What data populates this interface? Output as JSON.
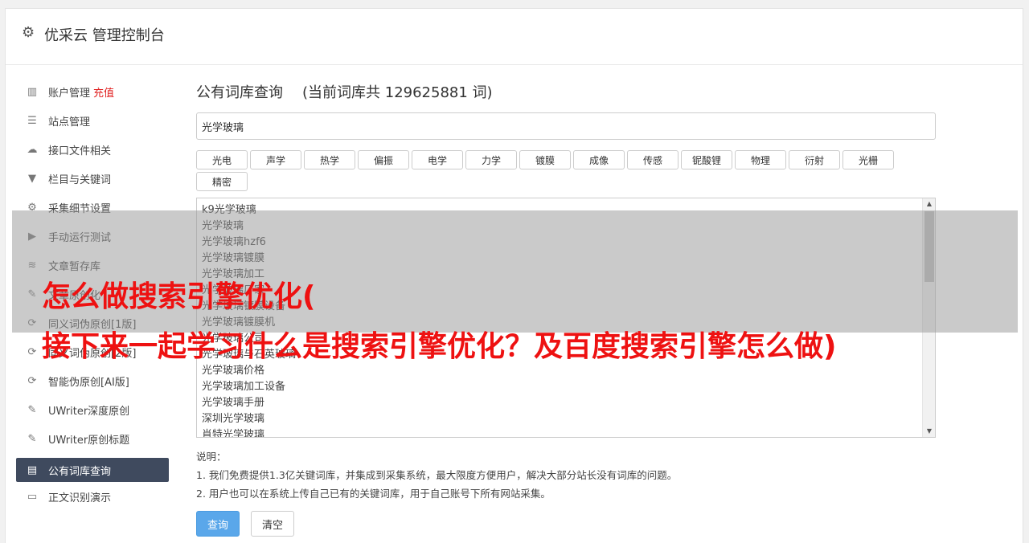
{
  "header": {
    "title": "优采云 管理控制台",
    "icon": "gear-icon"
  },
  "sidebar": {
    "items": [
      {
        "label": "账户管理",
        "extra": "充值",
        "icon": "bar-chart-icon",
        "glyph": "▥"
      },
      {
        "label": "站点管理",
        "icon": "server-icon",
        "glyph": "☰"
      },
      {
        "label": "接口文件相关",
        "icon": "cloud-upload-icon",
        "glyph": "☁"
      },
      {
        "label": "栏目与关键词",
        "icon": "filter-icon",
        "glyph": "▼"
      },
      {
        "label": "采集细节设置",
        "icon": "cogs-icon",
        "glyph": "⚙"
      },
      {
        "label": "手动运行测试",
        "icon": "play-circle-icon",
        "glyph": "▶"
      },
      {
        "label": "文章暂存库",
        "icon": "database-icon",
        "glyph": "≋"
      },
      {
        "label": "文章原创化",
        "icon": "edit-icon",
        "glyph": "✎"
      },
      {
        "label": "同义词伪原创[1版]",
        "icon": "refresh-icon",
        "glyph": "⟳"
      },
      {
        "label": "同义词伪原创[2版]",
        "icon": "refresh-icon",
        "glyph": "⟳"
      },
      {
        "label": "智能伪原创[AI版]",
        "icon": "refresh-icon",
        "glyph": "⟳"
      },
      {
        "label": "UWriter深度原创",
        "icon": "edit-icon",
        "glyph": "✎"
      },
      {
        "label": "UWriter原创标题",
        "icon": "edit-icon",
        "glyph": "✎"
      },
      {
        "label": "公有词库查询",
        "icon": "book-icon",
        "glyph": "▤",
        "active": true
      },
      {
        "label": "正文识别演示",
        "icon": "monitor-icon",
        "glyph": "▭"
      }
    ]
  },
  "main": {
    "title": "公有词库查询",
    "count_text": "(当前词库共 129625881 词)",
    "search_value": "光学玻璃",
    "tags": [
      "光电",
      "声学",
      "热学",
      "偏振",
      "电学",
      "力学",
      "镀膜",
      "成像",
      "传感",
      "铌酸锂",
      "物理",
      "衍射",
      "光栅",
      "精密"
    ],
    "results": [
      "k9光学玻璃",
      "光学玻璃",
      "光学玻璃hzf6",
      "光学玻璃镀膜",
      "光学玻璃加工",
      "光学玻璃厂家",
      "光学玻璃镀膜设备",
      "光学玻璃镀膜机",
      "光学玻璃公司",
      "光学玻璃与石英玻璃",
      "光学玻璃价格",
      "光学玻璃加工设备",
      "光学玻璃手册",
      "深圳光学玻璃",
      "肖特光学玻璃"
    ],
    "notes_title": "说明：",
    "notes": [
      "1. 我们免费提供1.3亿关键词库，并集成到采集系统，最大限度方便用户，解决大部分站长没有词库的问题。",
      "2. 用户也可以在系统上传自己已有的关键词库，用于自己账号下所有网站采集。"
    ],
    "query_button": "查询",
    "clear_button": "清空"
  },
  "overlay": {
    "line1": "怎么做搜索引擎优化(",
    "line2": "接下来一起学习什么是搜索引擎优化？及百度搜索引擎怎么做)"
  }
}
